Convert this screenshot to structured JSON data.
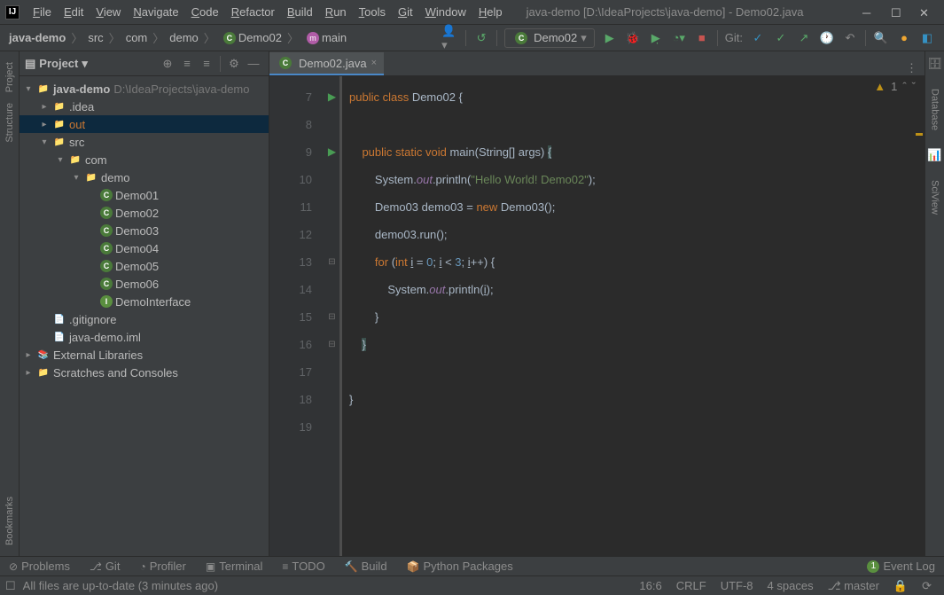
{
  "window": {
    "title": "java-demo [D:\\IdeaProjects\\java-demo] - Demo02.java",
    "menus": [
      "File",
      "Edit",
      "View",
      "Navigate",
      "Code",
      "Refactor",
      "Build",
      "Run",
      "Tools",
      "Git",
      "Window",
      "Help"
    ]
  },
  "breadcrumbs": {
    "project": "java-demo",
    "src": "src",
    "com": "com",
    "demo": "demo",
    "class": "Demo02",
    "method": "main"
  },
  "run_config": "Demo02",
  "left_tabs": {
    "project": "Project",
    "structure": "Structure",
    "bookmarks": "Bookmarks"
  },
  "right_tabs": {
    "database": "Database",
    "sciview": "SciView"
  },
  "project_panel": {
    "title": "Project",
    "root": "java-demo",
    "root_path": "D:\\IdeaProjects\\java-demo",
    "idea": ".idea",
    "out": "out",
    "src": "src",
    "com": "com",
    "demo": "demo",
    "classes": [
      "Demo01",
      "Demo02",
      "Demo03",
      "Demo04",
      "Demo05",
      "Demo06"
    ],
    "iface": "DemoInterface",
    "gitignore": ".gitignore",
    "iml": "java-demo.iml",
    "ext": "External Libraries",
    "scratches": "Scratches and Consoles"
  },
  "tab": {
    "label": "Demo02.java"
  },
  "editor": {
    "warnings": "1",
    "lines": [
      7,
      8,
      9,
      10,
      11,
      12,
      13,
      14,
      15,
      16,
      17,
      18,
      19
    ],
    "code": {
      "l7": "public class Demo02 {",
      "l9_kw": "public static void",
      "l9_m": "main",
      "l9_args": "(String[] args) ",
      "l9_brace": "{",
      "l10a": "System.",
      "l10b": "out",
      "l10c": ".println(",
      "l10d": "\"Hello World! Demo02\"",
      "l10e": ");",
      "l11a": "Demo03 demo03 = ",
      "l11b": "new ",
      "l11c": "Demo03();",
      "l12": "demo03.run();",
      "l13a": "for ",
      "l13b": "(",
      "l13c": "int ",
      "l13d": "i",
      " l13e": " = ",
      "l13f": "0",
      "l13g": "; ",
      "l13h": "i",
      "l13i": " < ",
      "l13j": "3",
      "l13k": "; ",
      "l13l": "i",
      "l13m": "++) {",
      "l14a": "System.",
      "l14b": "out",
      "l14c": ".println(",
      "l14d": "i",
      "l14e": ");",
      "l15": "}",
      "l16": "}",
      "l18": "}"
    }
  },
  "toolwindows": {
    "problems": "Problems",
    "git": "Git",
    "profiler": "Profiler",
    "terminal": "Terminal",
    "todo": "TODO",
    "build": "Build",
    "python": "Python Packages",
    "eventlog": "Event Log",
    "event_count": "1"
  },
  "status": {
    "msg": "All files are up-to-date (3 minutes ago)",
    "pos": "16:6",
    "sep": "CRLF",
    "enc": "UTF-8",
    "indent": "4 spaces",
    "branch": "master"
  }
}
